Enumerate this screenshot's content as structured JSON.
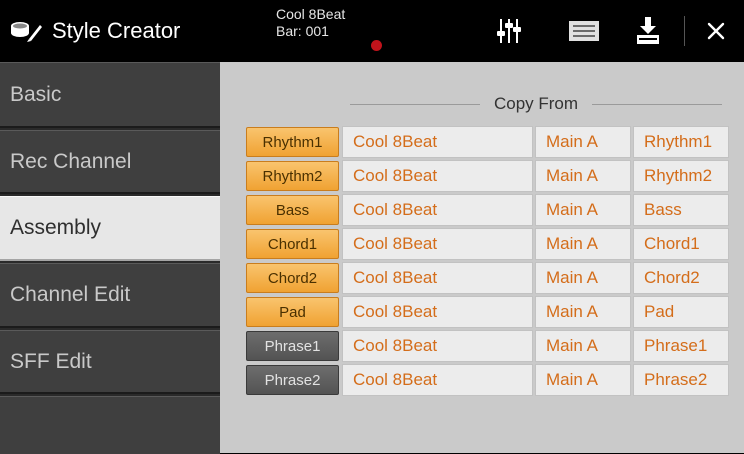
{
  "header": {
    "title": "Style Creator",
    "song_name": "Cool 8Beat",
    "bar_label": "Bar: 001",
    "icons": [
      "mixer-icon",
      "list-icon",
      "save-icon",
      "close-icon"
    ],
    "record_color": "#c1131b"
  },
  "sidebar": {
    "items": [
      {
        "label": "Basic",
        "active": false
      },
      {
        "label": "Rec Channel",
        "active": false
      },
      {
        "label": "Assembly",
        "active": true
      },
      {
        "label": "Channel Edit",
        "active": false
      },
      {
        "label": "SFF Edit",
        "active": false
      }
    ]
  },
  "main": {
    "copy_from_label": "Copy From",
    "rows": [
      {
        "part": "Rhythm1",
        "on": true,
        "style": "Cool 8Beat",
        "section": "Main A",
        "source": "Rhythm1"
      },
      {
        "part": "Rhythm2",
        "on": true,
        "style": "Cool 8Beat",
        "section": "Main A",
        "source": "Rhythm2"
      },
      {
        "part": "Bass",
        "on": true,
        "style": "Cool 8Beat",
        "section": "Main A",
        "source": "Bass"
      },
      {
        "part": "Chord1",
        "on": true,
        "style": "Cool 8Beat",
        "section": "Main A",
        "source": "Chord1"
      },
      {
        "part": "Chord2",
        "on": true,
        "style": "Cool 8Beat",
        "section": "Main A",
        "source": "Chord2"
      },
      {
        "part": "Pad",
        "on": true,
        "style": "Cool 8Beat",
        "section": "Main A",
        "source": "Pad"
      },
      {
        "part": "Phrase1",
        "on": false,
        "style": "Cool 8Beat",
        "section": "Main A",
        "source": "Phrase1"
      },
      {
        "part": "Phrase2",
        "on": false,
        "style": "Cool 8Beat",
        "section": "Main A",
        "source": "Phrase2"
      }
    ]
  },
  "colors": {
    "accent_orange": "#f0a232",
    "value_text": "#d46d1a",
    "active_tab": "#e7e7e7",
    "inactive_tab": "#3f3f3f"
  }
}
